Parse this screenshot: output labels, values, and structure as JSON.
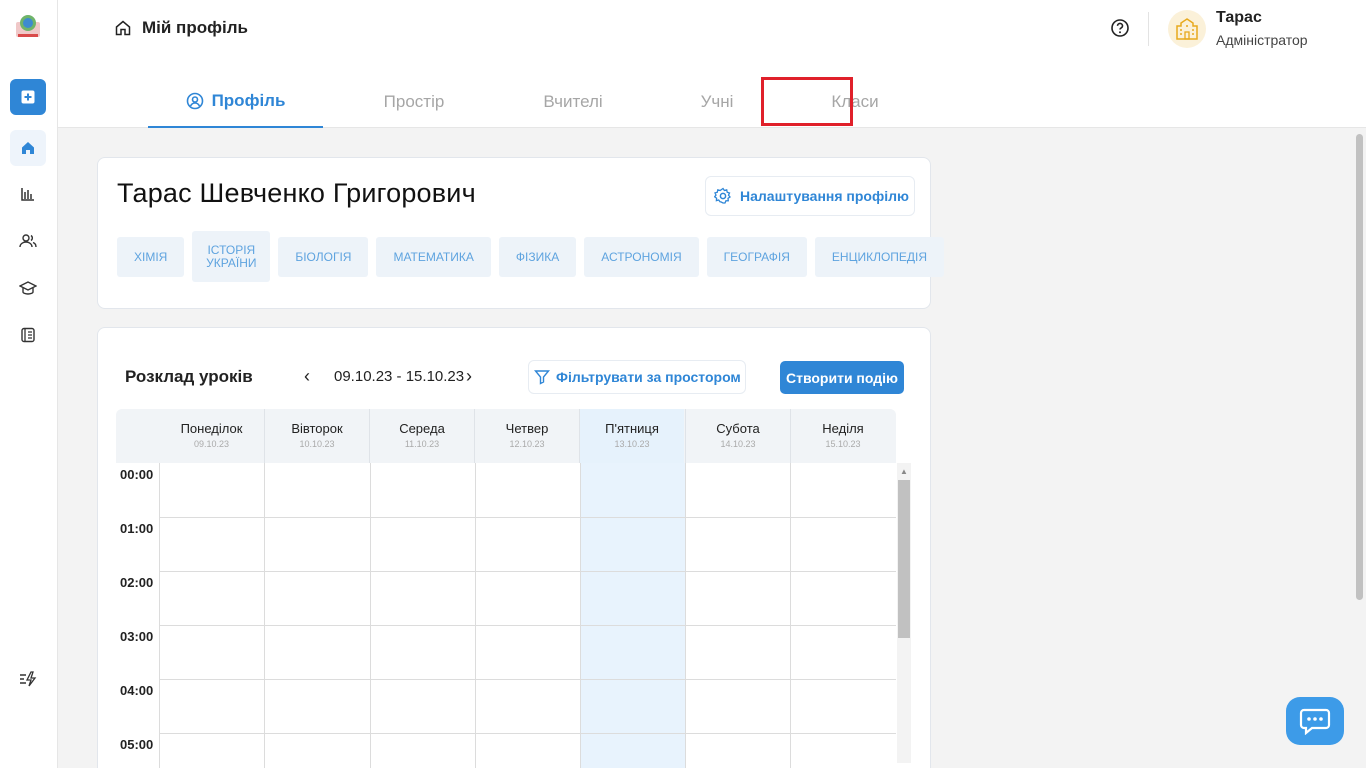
{
  "header": {
    "breadcrumb_title": "Мій профіль",
    "user_name": "Тарас",
    "user_role": "Адміністратор"
  },
  "tabs": [
    {
      "label": "Профіль",
      "active": true
    },
    {
      "label": "Простір",
      "active": false
    },
    {
      "label": "Вчителі",
      "active": false
    },
    {
      "label": "Учні",
      "active": false,
      "highlighted": true
    },
    {
      "label": "Класи",
      "active": false
    }
  ],
  "profile": {
    "full_name": "Тарас Шевченко Григорович",
    "settings_label": "Налаштування профілю",
    "subjects": [
      "ХІМІЯ",
      "ІСТОРІЯ УКРАЇНИ",
      "БІОЛОГІЯ",
      "МАТЕМАТИКА",
      "ФІЗИКА",
      "АСТРОНОМІЯ",
      "ГЕОГРАФІЯ",
      "ЕНЦИКЛОПЕДІЯ"
    ]
  },
  "schedule": {
    "title": "Розклад уроків",
    "date_range": "09.10.23 - 15.10.23",
    "prev_symbol": "‹",
    "next_symbol": "›",
    "filter_label": "Фільтрувати за простором",
    "create_label": "Створити подію",
    "days": [
      {
        "name": "Понеділок",
        "date": "09.10.23"
      },
      {
        "name": "Вівторок",
        "date": "10.10.23"
      },
      {
        "name": "Середа",
        "date": "11.10.23"
      },
      {
        "name": "Четвер",
        "date": "12.10.23"
      },
      {
        "name": "П'ятниця",
        "date": "13.10.23",
        "today": true
      },
      {
        "name": "Субота",
        "date": "14.10.23"
      },
      {
        "name": "Неділя",
        "date": "15.10.23"
      }
    ],
    "hours": [
      "00:00",
      "01:00",
      "02:00",
      "03:00",
      "04:00",
      "05:00"
    ]
  },
  "icons": {
    "sidebar": [
      "add-icon",
      "home-icon",
      "chart-icon",
      "users-icon",
      "graduation-cap-icon",
      "journal-icon",
      "quick-actions-icon"
    ],
    "header": [
      "home-icon",
      "help-icon",
      "school-icon"
    ],
    "misc": [
      "profile-icon",
      "gear-icon",
      "filter-icon",
      "chat-icon"
    ]
  },
  "colors": {
    "accent": "#2f86d6",
    "highlight": "#e0202a",
    "today_bg": "#e8f3fd",
    "chip_bg": "#edf3f9"
  }
}
